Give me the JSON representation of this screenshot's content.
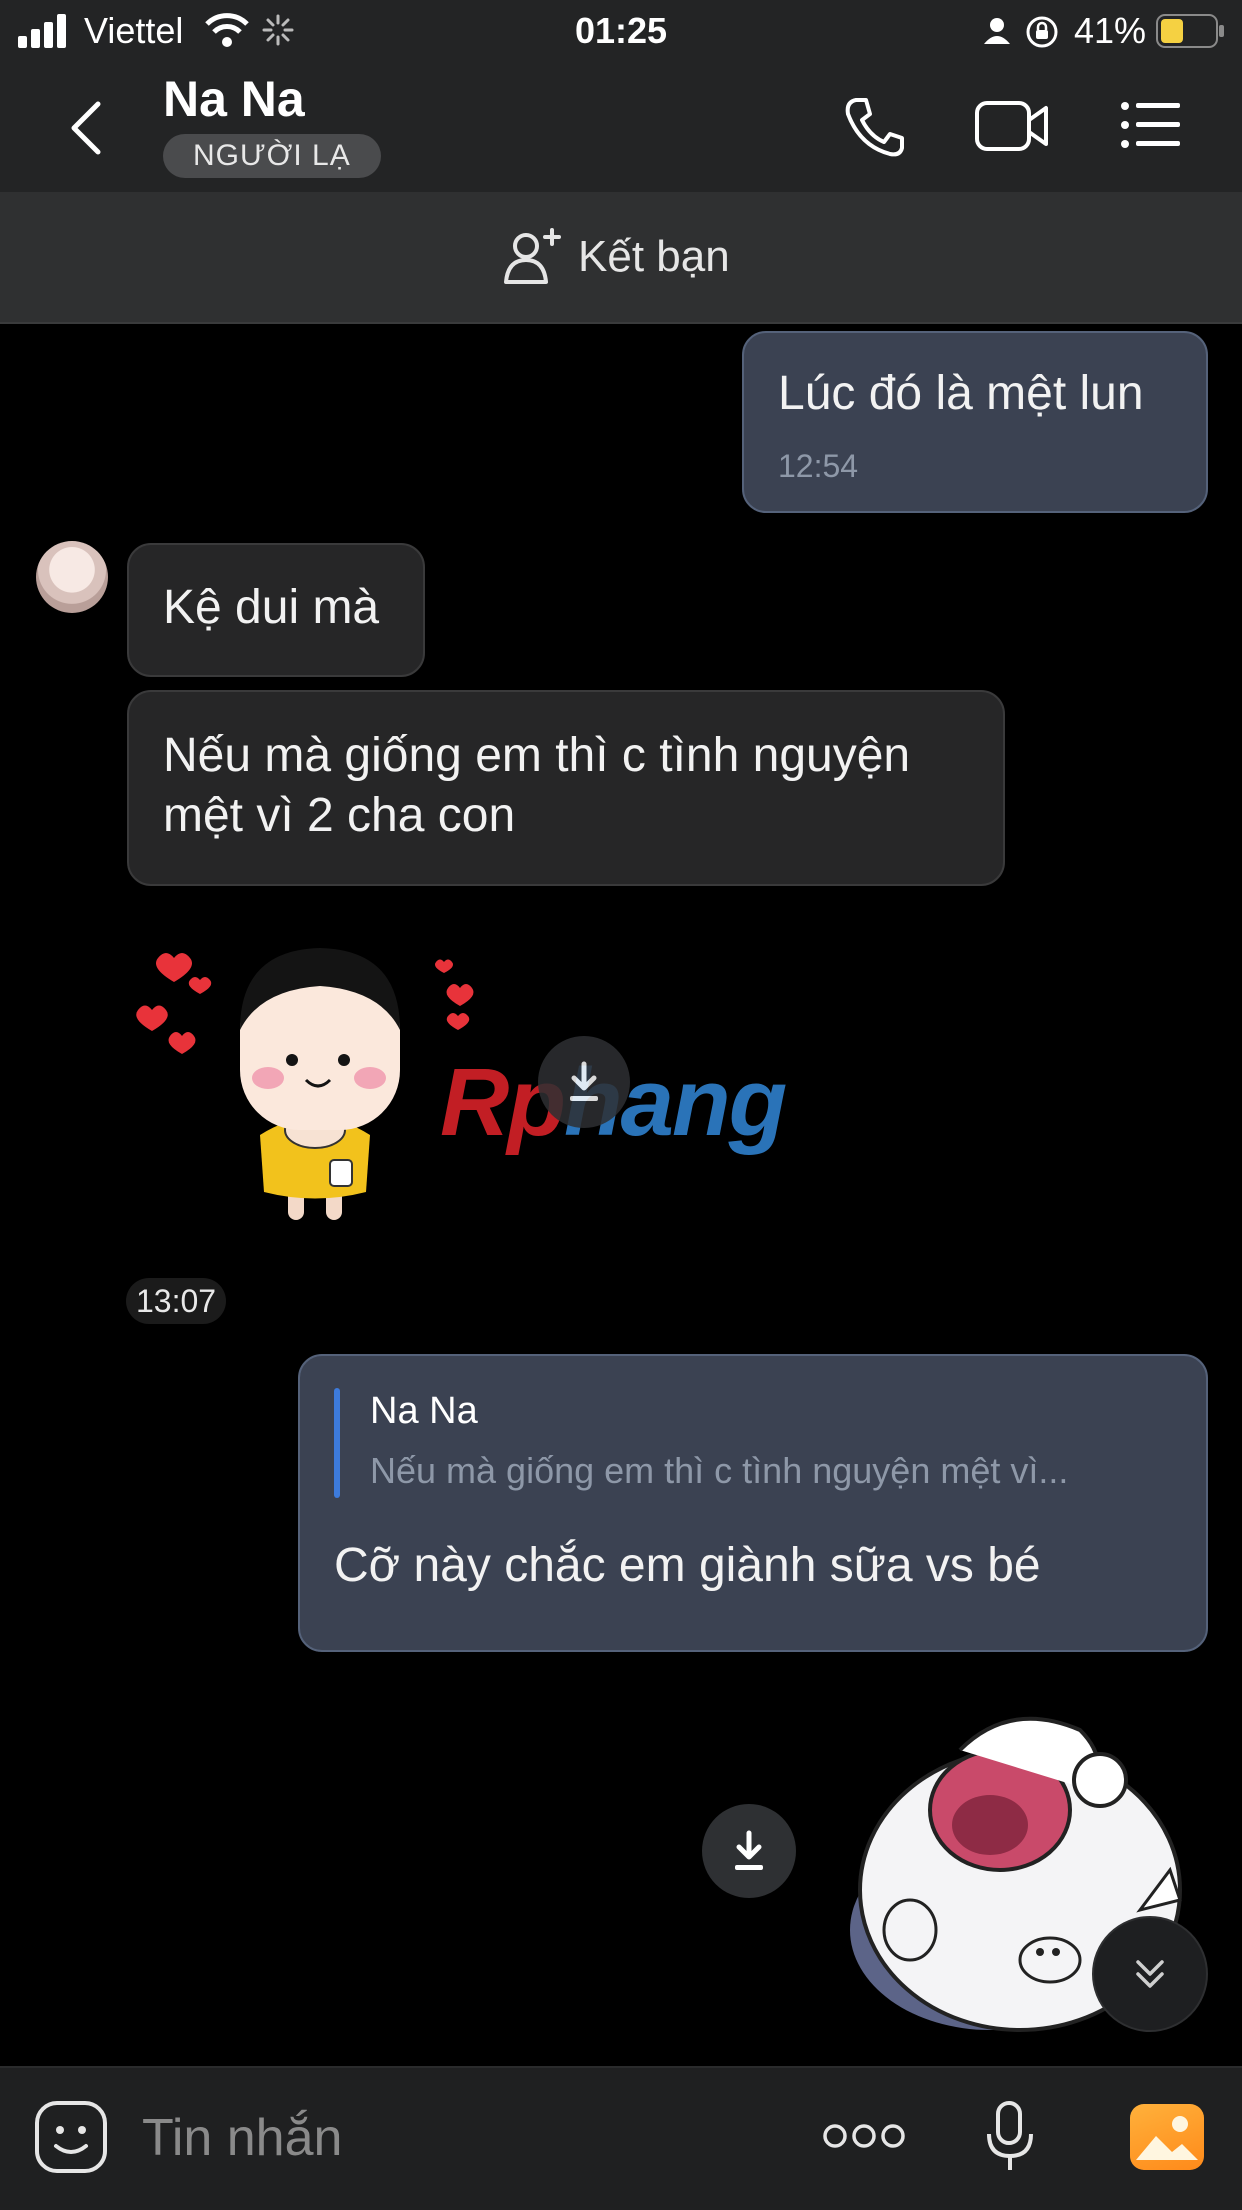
{
  "status_bar": {
    "carrier": "Viettel",
    "time": "01:25",
    "battery": "41%"
  },
  "header": {
    "title": "Na Na",
    "badge": "NGƯỜI LẠ"
  },
  "friend_bar": {
    "label": "Kết bạn"
  },
  "messages": [
    {
      "direction": "outgoing",
      "text": "Lúc đó là mệt lun",
      "time": "12:54"
    },
    {
      "direction": "incoming",
      "text": "Kệ dui mà"
    },
    {
      "direction": "incoming",
      "text_line1": "Nếu mà giống em thì c tình nguyện",
      "text_line2": "mệt vì 2 cha con"
    },
    {
      "direction": "incoming",
      "type": "sticker",
      "time": "13:07"
    },
    {
      "direction": "outgoing",
      "quote_name": "Na Na",
      "quote_text": "Nếu mà giống em thì c tình nguyện mệt vì...",
      "text": "Cỡ này chắc em giành sữa vs bé"
    },
    {
      "direction": "outgoing",
      "type": "sticker"
    }
  ],
  "watermark": {
    "part1": "Rp",
    "part2": "hang"
  },
  "composer": {
    "placeholder": "Tin nhắn"
  },
  "icons": [
    "back-icon",
    "phone-icon",
    "video-icon",
    "menu-icon",
    "add-friend-icon",
    "download-icon",
    "scroll-down-icon",
    "emoji-icon",
    "more-icon",
    "voice-icon",
    "gallery-icon"
  ],
  "colors": {
    "outgoing_bubble": "#3b4252",
    "incoming_bubble": "#262627",
    "accent": "#3d7bdc",
    "gallery": "#ff9a2a"
  }
}
